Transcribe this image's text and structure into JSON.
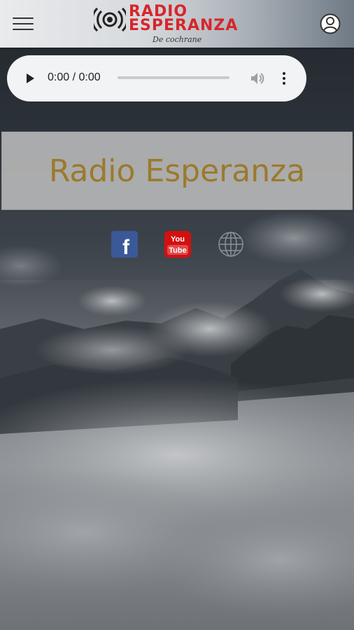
{
  "header": {
    "menu_icon": "hamburger-menu-icon",
    "logo_line1": "RADIO",
    "logo_line2": "ESPERANZA",
    "logo_subtitle": "De cochrane",
    "profile_icon": "user-profile-icon",
    "brand_color": "#d6262c"
  },
  "player": {
    "time": "0:00 / 0:00",
    "progress": 0,
    "play_icon": "play-icon",
    "volume_icon": "volume-icon",
    "more_icon": "more-options-icon"
  },
  "main": {
    "title": "Radio Esperanza",
    "title_color": "#9b7a2d"
  },
  "social": [
    {
      "icon": "facebook-icon",
      "label": "f"
    },
    {
      "icon": "youtube-icon",
      "label_top": "You",
      "label_bottom": "Tube"
    },
    {
      "icon": "globe-icon"
    }
  ]
}
